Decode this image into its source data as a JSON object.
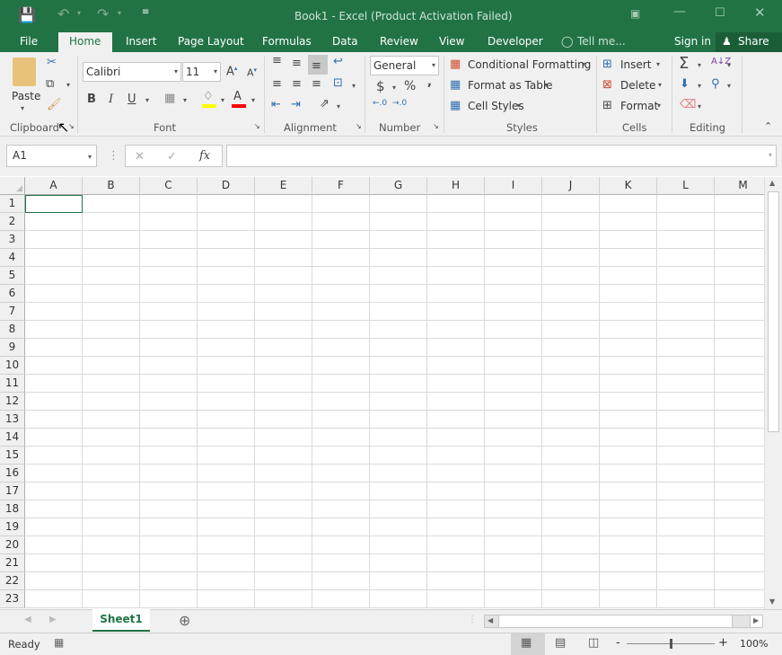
{
  "window": {
    "title": "Book1 - Excel (Product Activation Failed)"
  },
  "quick_access": {
    "save_icon": "save-icon",
    "undo_icon": "undo-icon",
    "redo_icon": "redo-icon",
    "customize_icon": "customize-icon"
  },
  "window_controls": {
    "ribbon_display": "ribbon-display-icon",
    "minimize": "minimize-icon",
    "maximize": "maximize-icon",
    "close": "close-icon"
  },
  "tabs": [
    {
      "label": "File"
    },
    {
      "label": "Home"
    },
    {
      "label": "Insert"
    },
    {
      "label": "Page Layout"
    },
    {
      "label": "Formulas"
    },
    {
      "label": "Data"
    },
    {
      "label": "Review"
    },
    {
      "label": "View"
    },
    {
      "label": "Developer"
    },
    {
      "label": "Tell me..."
    }
  ],
  "account": {
    "sign_in": "Sign in",
    "share": "Share"
  },
  "ribbon": {
    "clipboard": {
      "label": "Clipboard",
      "paste": "Paste"
    },
    "font": {
      "label": "Font",
      "font_name": "Calibri",
      "font_size": "11",
      "bold": "B",
      "italic": "I",
      "underline": "U",
      "font_color_letter": "A",
      "fill_color": "#ffff00",
      "font_color": "#ff0000"
    },
    "alignment": {
      "label": "Alignment"
    },
    "number": {
      "label": "Number",
      "format": "General",
      "currency": "$",
      "percent": "%",
      "comma": ","
    },
    "styles": {
      "label": "Styles",
      "conditional": "Conditional Formatting",
      "format_table": "Format as Table",
      "cell_styles": "Cell Styles"
    },
    "cells": {
      "label": "Cells",
      "insert": "Insert",
      "delete": "Delete",
      "format": "Format"
    },
    "editing": {
      "label": "Editing",
      "sum": "Σ"
    }
  },
  "formula_bar": {
    "name_box": "A1",
    "fx": "fx",
    "formula": ""
  },
  "grid": {
    "columns": [
      "A",
      "B",
      "C",
      "D",
      "E",
      "F",
      "G",
      "H",
      "I",
      "J",
      "K",
      "L",
      "M"
    ],
    "rows": [
      "1",
      "2",
      "3",
      "4",
      "5",
      "6",
      "7",
      "8",
      "9",
      "10",
      "11",
      "12",
      "13",
      "14",
      "15",
      "16",
      "17",
      "18",
      "19",
      "20",
      "21",
      "22",
      "23"
    ]
  },
  "sheets": [
    {
      "label": "Sheet1",
      "active": true
    }
  ],
  "status": {
    "ready": "Ready",
    "zoom": "100%",
    "zoom_minus": "-",
    "zoom_plus": "+",
    "zoom_level": 100
  },
  "colors": {
    "brand": "#217346",
    "ribbon_bg": "#f0f0f0"
  }
}
